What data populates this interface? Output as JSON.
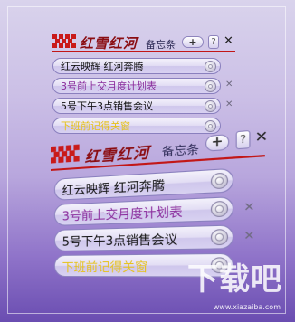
{
  "brand": "红雪红河",
  "subtitle": "备忘条",
  "add_label": "+",
  "help_label": "?",
  "close_label": "✕",
  "delete_label": "✕",
  "colors": {
    "accent_red": "#c21717",
    "purple_text": "#8a2c9c",
    "yellow_text": "#e6c21a"
  },
  "notes": [
    {
      "text": "红云映辉   红河奔腾",
      "color": "#111111"
    },
    {
      "text": "3号前上交月度计划表",
      "color": "#8a2c9c"
    },
    {
      "text": "5号下午3点销售会议",
      "color": "#111111"
    },
    {
      "text": "下班前记得关窗",
      "color": "#e6c21a"
    }
  ],
  "watermark": {
    "text": "下载吧",
    "url": "www.xiazaiba.com"
  }
}
